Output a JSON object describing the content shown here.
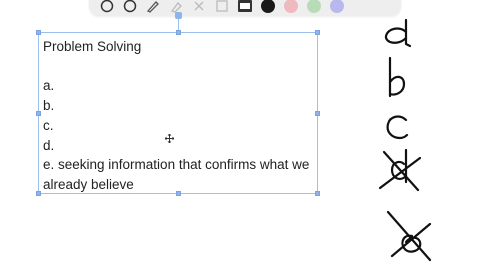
{
  "toolbar": {
    "tools": [
      {
        "icon": "circle-outline-icon"
      },
      {
        "icon": "circle-outline-icon"
      },
      {
        "icon": "pen-icon"
      },
      {
        "icon": "highlighter-icon"
      },
      {
        "icon": "eraser-icon"
      },
      {
        "icon": "image-icon"
      },
      {
        "icon": "textbox-icon"
      }
    ],
    "colors": [
      "#1a1a1a",
      "#f0b8bf",
      "#b8dcb7",
      "#b8b8ef"
    ]
  },
  "textbox": {
    "lines": [
      "Problem Solving",
      "",
      "a.",
      "b.",
      "c.",
      "d.",
      "e. seeking information that confirms what we already believe"
    ]
  },
  "handwriting": {
    "letters": [
      "a",
      "b",
      "c",
      "d",
      "e"
    ],
    "crossed_out": [
      "d",
      "e"
    ],
    "ink_color": "#111111"
  }
}
